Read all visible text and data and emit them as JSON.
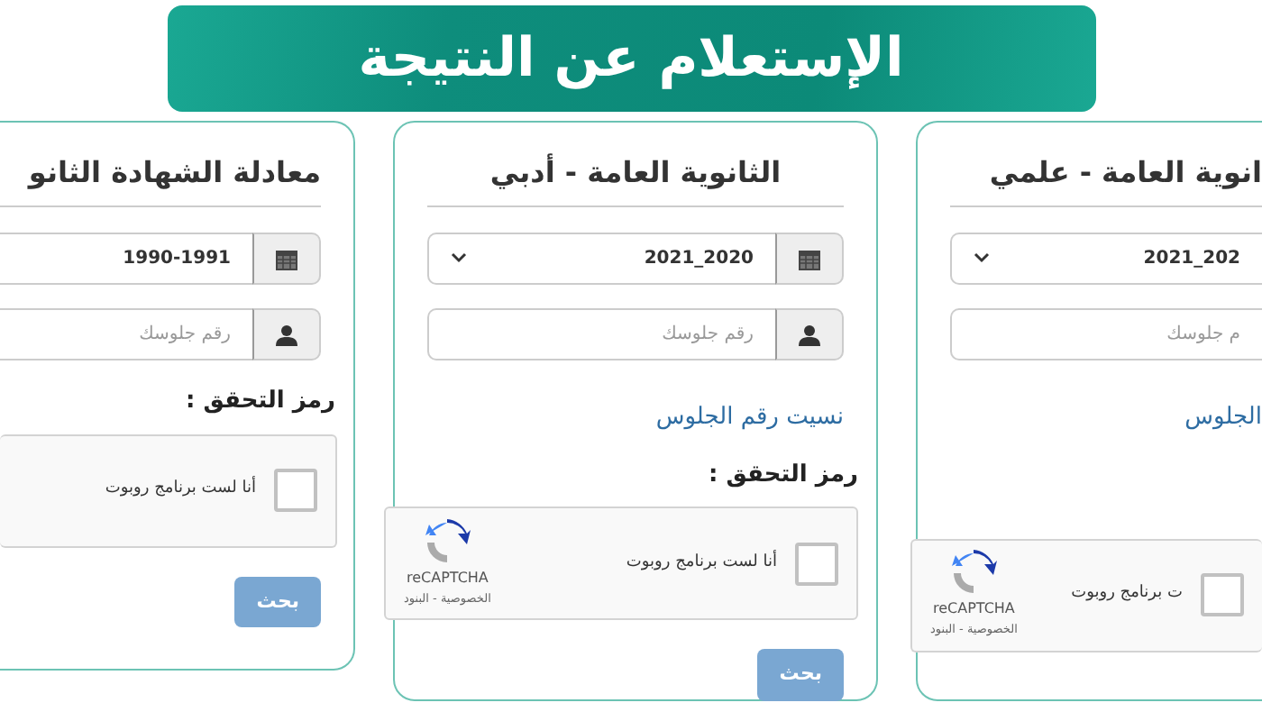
{
  "banner": {
    "title": "الإستعلام عن النتيجة"
  },
  "cards": [
    {
      "kind": "cut_right",
      "title": "انوية العامة - علمي",
      "year": {
        "value": "2021_202"
      },
      "seat": {
        "placeholder": "م جلوسك"
      },
      "forgot_link": "الجلوس",
      "captcha": {
        "checkbox_label": "ت برنامج روبوت",
        "checked": false,
        "brand": "reCAPTCHA",
        "terms": "الخصوصية - البنود"
      }
    },
    {
      "kind": "full",
      "title": "الثانوية العامة - أدبي",
      "year": {
        "value": "2021_2020"
      },
      "seat": {
        "placeholder": "رقم جلوسك"
      },
      "forgot_link": "نسيت رقم الجلوس",
      "captcha_label": "رمز التحقق :",
      "captcha": {
        "checkbox_label": "أنا لست برنامج روبوت",
        "checked": false,
        "brand": "reCAPTCHA",
        "terms": "الخصوصية - البنود"
      },
      "search_button": "بحث"
    },
    {
      "kind": "cut_left",
      "title": "معادلة الشهادة الثانو",
      "year": {
        "value": "1990-1991"
      },
      "seat": {
        "placeholder": "رقم جلوسك"
      },
      "captcha_label": "رمز التحقق :",
      "captcha": {
        "checkbox_label": "أنا لست برنامج روبوت",
        "checked": false
      },
      "search_button": "بحث"
    }
  ]
}
